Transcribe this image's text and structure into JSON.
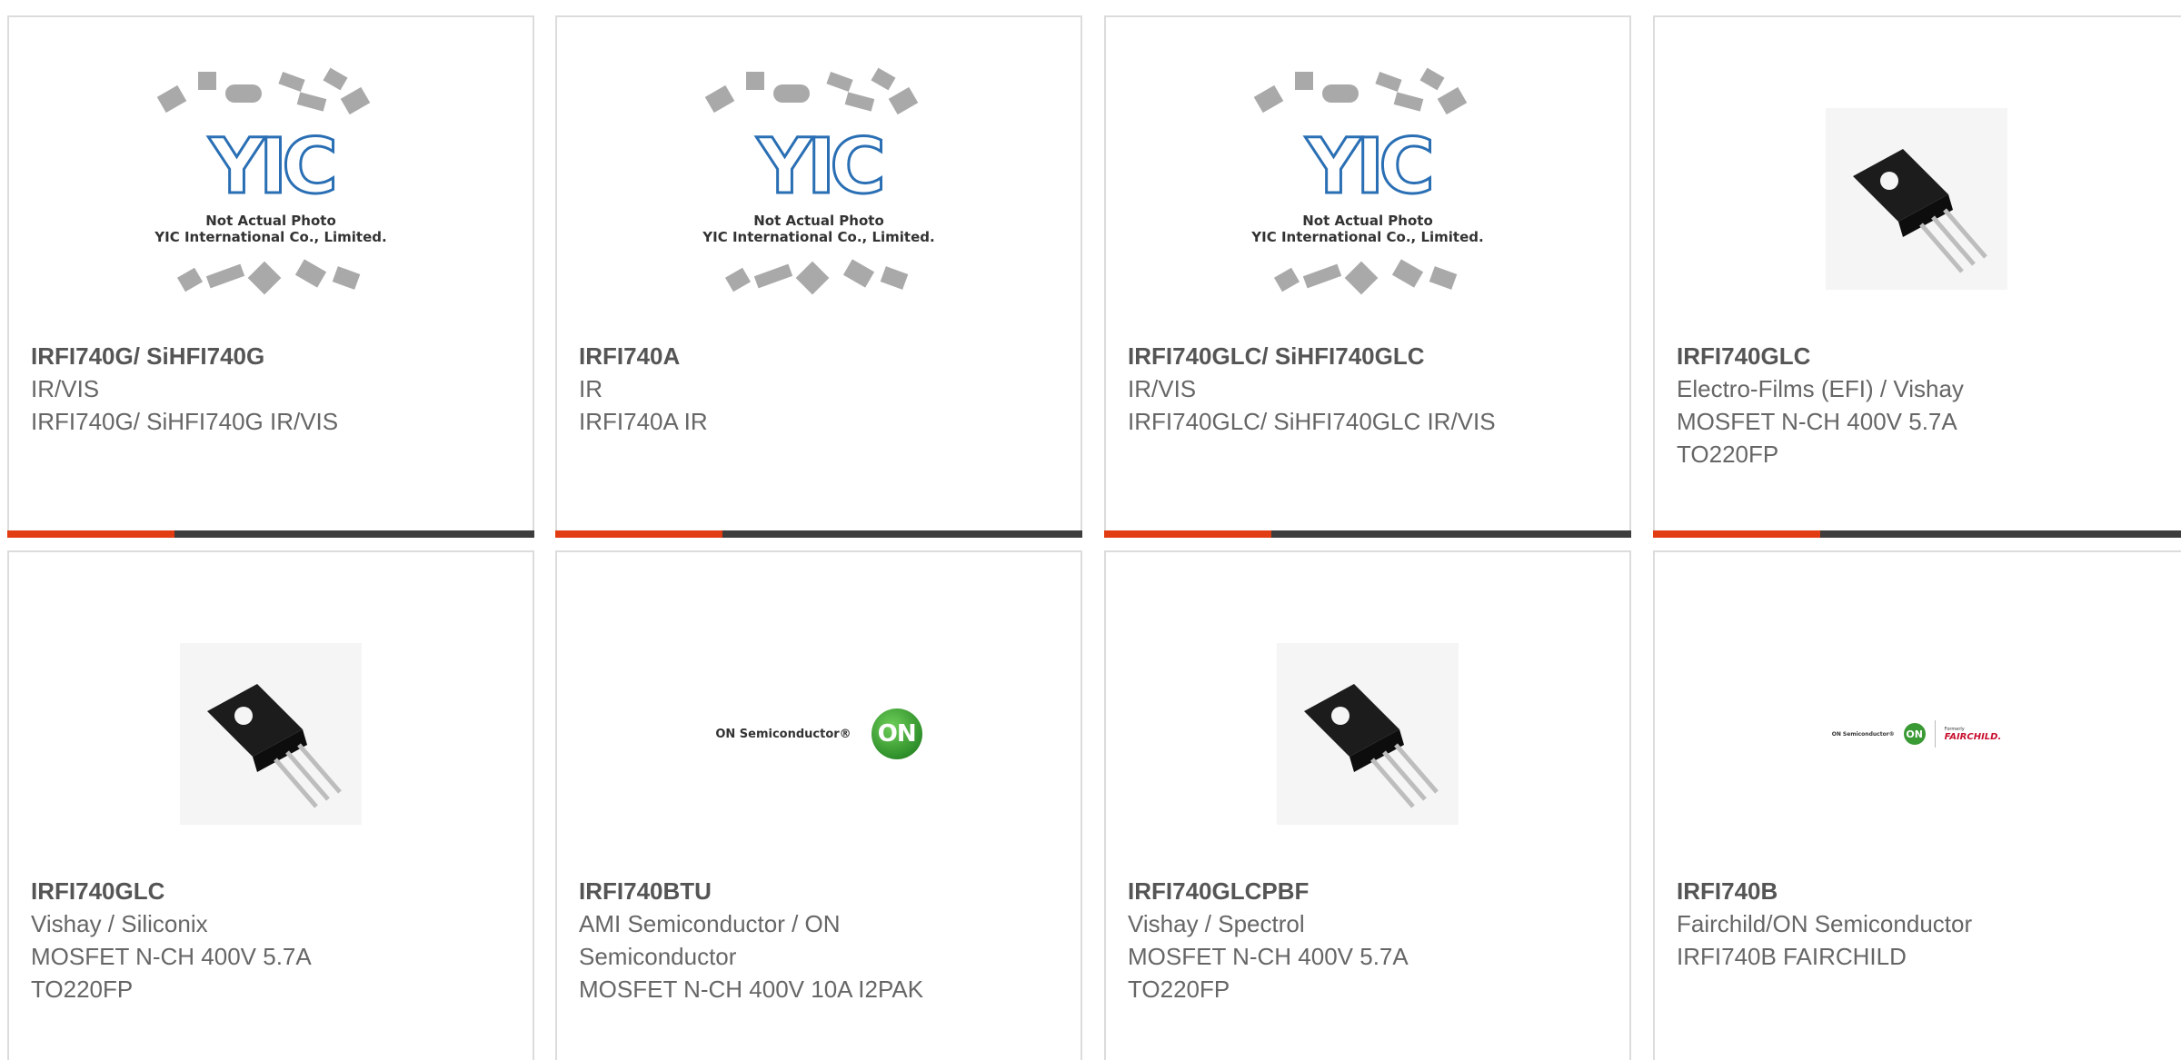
{
  "products": [
    {
      "image": "yic-placeholder",
      "title": "IRFI740G/ SiHFI740G",
      "maker": "IR/VIS",
      "desc": "IRFI740G/ SiHFI740G IR/VIS"
    },
    {
      "image": "yic-placeholder",
      "title": "IRFI740A",
      "maker": "IR",
      "desc": "IRFI740A IR"
    },
    {
      "image": "yic-placeholder",
      "title": "IRFI740GLC/ SiHFI740GLC",
      "maker": "IR/VIS",
      "desc": "IRFI740GLC/ SiHFI740GLC IR/VIS"
    },
    {
      "image": "to220-transistor",
      "title": "IRFI740GLC",
      "maker": "Electro-Films (EFI) / Vishay",
      "desc": "MOSFET N-CH 400V 5.7A TO220FP"
    },
    {
      "image": "to220-transistor",
      "title": "IRFI740GLC",
      "maker": "Vishay / Siliconix",
      "desc": "MOSFET N-CH 400V 5.7A TO220FP"
    },
    {
      "image": "on-semiconductor-logo",
      "title": "IRFI740BTU",
      "maker": "AMI Semiconductor / ON Semiconductor",
      "desc": "MOSFET N-CH 400V 10A I2PAK"
    },
    {
      "image": "to220-transistor",
      "title": "IRFI740GLCPBF",
      "maker": "Vishay / Spectrol",
      "desc": "MOSFET N-CH 400V 5.7A TO220FP"
    },
    {
      "image": "on-fairchild-logo",
      "title": "IRFI740B",
      "maker": "Fairchild/ON Semiconductor",
      "desc": "IRFI740B FAIRCHILD"
    }
  ],
  "placeholder": {
    "logo_text": "YIC",
    "caption1": "Not Actual Photo",
    "caption2": "YIC International Co., Limited."
  },
  "logos": {
    "on_text": "ON Semiconductor®",
    "on_mark": "ON",
    "fairchild_formerly": "Formerly",
    "fairchild": "FAIRCHILD."
  },
  "colors": {
    "accent": "#e23c12",
    "bar": "#3d3d3d",
    "border": "#dcdcdc",
    "title": "#555555",
    "text": "#666666"
  }
}
